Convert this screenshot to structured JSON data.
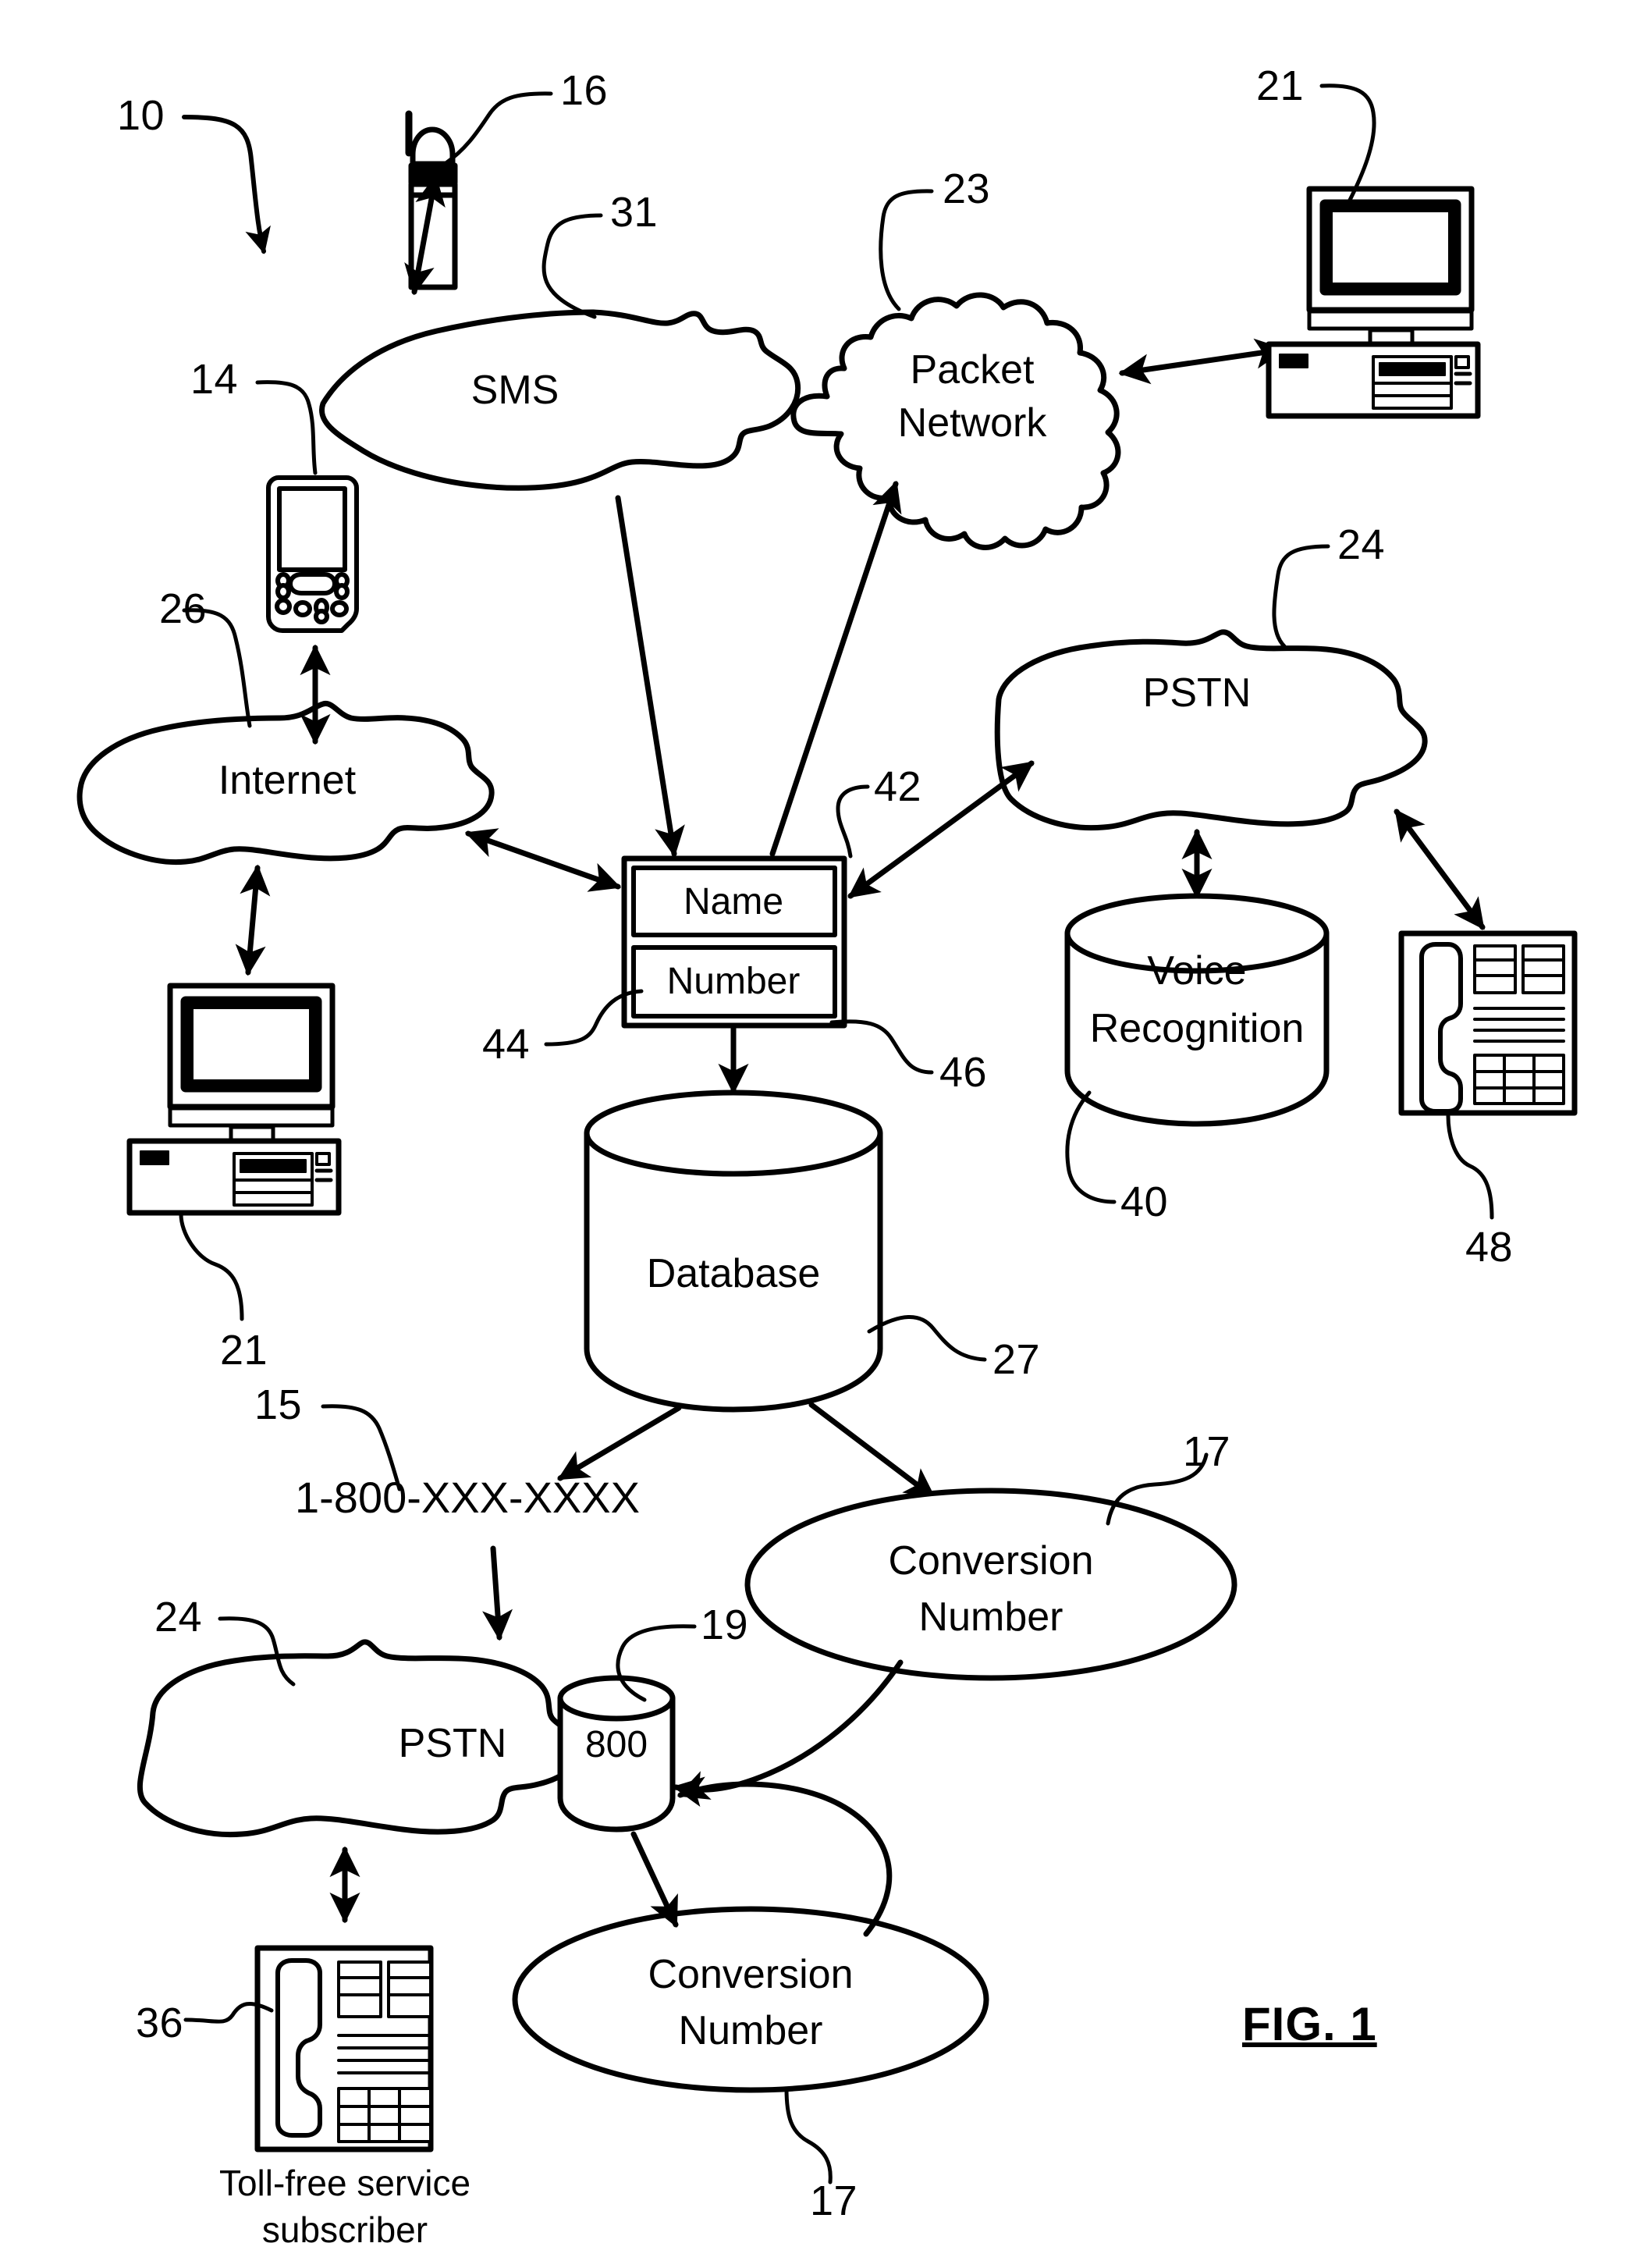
{
  "figure": {
    "label": "FIG. 1",
    "system_ref": "10"
  },
  "nodes": [
    {
      "id": "sms",
      "label": "SMS",
      "ref": "31"
    },
    {
      "id": "packet_network",
      "label": "Packet\nNetwork",
      "ref": "23"
    },
    {
      "id": "internet",
      "label": "Internet",
      "ref": "26"
    },
    {
      "id": "pstn_top",
      "label": "PSTN",
      "ref": "24"
    },
    {
      "id": "voice_recognition",
      "label": "Voice\nRecognition",
      "ref": "40"
    },
    {
      "id": "database",
      "label": "Database",
      "ref": "27"
    },
    {
      "id": "pstn_bottom",
      "label": "PSTN",
      "ref": "24"
    },
    {
      "id": "eight_hundred_db",
      "label": "800",
      "ref": "19"
    },
    {
      "id": "conversion_number_right",
      "label": "Conversion\nNumber",
      "ref": "17"
    },
    {
      "id": "conversion_number_bottom",
      "label": "Conversion\nNumber",
      "ref": "17"
    }
  ],
  "devices": [
    {
      "id": "mobile_phone",
      "ref": "16"
    },
    {
      "id": "pda",
      "ref": "14"
    },
    {
      "id": "computer_top_right",
      "ref": "21"
    },
    {
      "id": "computer_left",
      "ref": "21"
    },
    {
      "id": "telephone_right",
      "ref": "48"
    },
    {
      "id": "telephone_bottom",
      "ref": "36",
      "caption": "Toll-free service\nsubscriber"
    }
  ],
  "name_number_box": {
    "ref": "42",
    "name_row": {
      "label": "Name",
      "ref": "44"
    },
    "number_row": {
      "label": "Number",
      "ref": "46"
    }
  },
  "toll_free_number": {
    "value": "1-800-XXX-XXXX",
    "ref": "15"
  },
  "refs": {
    "r10": "10",
    "r14": "14",
    "r15": "15",
    "r16": "16",
    "r17a": "17",
    "r17b": "17",
    "r19": "19",
    "r21a": "21",
    "r21b": "21",
    "r23": "23",
    "r24a": "24",
    "r24b": "24",
    "r26": "26",
    "r27": "27",
    "r31": "31",
    "r36": "36",
    "r40": "40",
    "r42": "42",
    "r44": "44",
    "r46": "46",
    "r48": "48"
  },
  "text": {
    "sms": "SMS",
    "packet": "Packet",
    "network": "Network",
    "internet": "Internet",
    "pstn_top": "PSTN",
    "voice": "Voice",
    "recognition": "Recognition",
    "database": "Database",
    "pstn_bottom": "PSTN",
    "eight_hundred": "800",
    "conv1_line1": "Conversion",
    "conv1_line2": "Number",
    "conv2_line1": "Conversion",
    "conv2_line2": "Number",
    "name": "Name",
    "number": "Number",
    "tollfree_number": "1-800-XXX-XXXX",
    "subscriber_line1": "Toll-free service",
    "subscriber_line2": "subscriber",
    "fig": "FIG. 1"
  },
  "colors": {
    "ink": "#000000",
    "paper": "#ffffff"
  }
}
